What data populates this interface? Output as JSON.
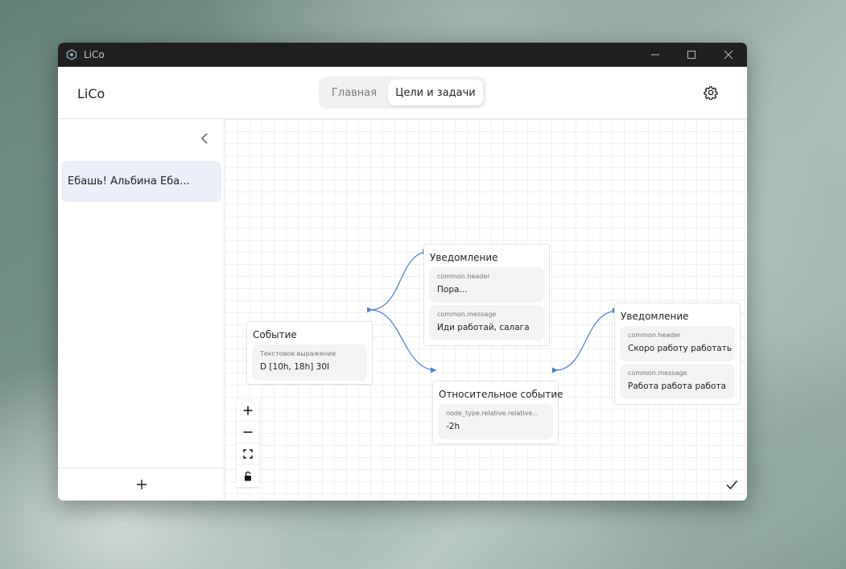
{
  "window": {
    "title": "LiCo"
  },
  "header": {
    "brand": "LiCo",
    "tabs": [
      {
        "label": "Главная",
        "active": false
      },
      {
        "label": "Цели и задачи",
        "active": true
      }
    ]
  },
  "sidebar": {
    "items": [
      {
        "label": "Ебашь! Альбина Еба..."
      }
    ]
  },
  "nodes": {
    "event": {
      "title": "Событие",
      "fields": [
        {
          "key": "Текстовое выражение",
          "value": "D [10h, 18h] 30I"
        }
      ]
    },
    "notification1": {
      "title": "Уведомление",
      "fields": [
        {
          "key": "common.header",
          "value": "Пора..."
        },
        {
          "key": "common.message",
          "value": "Иди работай, салага"
        }
      ]
    },
    "relative_event": {
      "title": "Относительное событие",
      "fields": [
        {
          "key": "node_type.relative.relative...",
          "value": "-2h"
        }
      ]
    },
    "notification2": {
      "title": "Уведомление",
      "fields": [
        {
          "key": "common.header",
          "value": "Скоро работу работать"
        },
        {
          "key": "common.message",
          "value": "Работа работа работа"
        }
      ]
    }
  },
  "colors": {
    "edge": "#4a7fd6",
    "selected_item": "#e9eef8"
  }
}
